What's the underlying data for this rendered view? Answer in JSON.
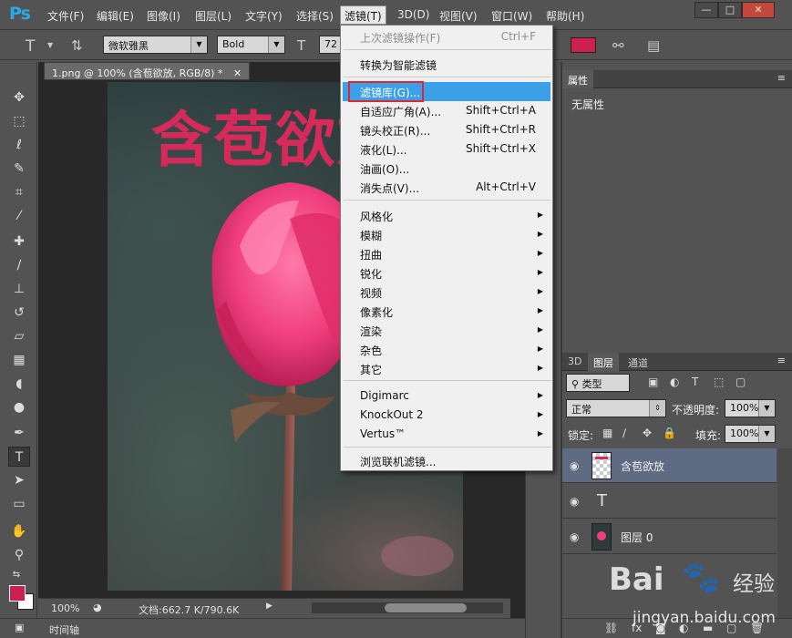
{
  "app": {
    "logo": "Ps"
  },
  "menubar": {
    "items": [
      "文件(F)",
      "编辑(E)",
      "图像(I)",
      "图层(L)",
      "文字(Y)",
      "选择(S)",
      "滤镜(T)",
      "3D(D)",
      "视图(V)",
      "窗口(W)",
      "帮助(H)"
    ],
    "active_index": 6,
    "window_buttons": [
      "—",
      "□",
      "✕"
    ]
  },
  "options_bar": {
    "font_family": "微软雅黑",
    "font_style": "Bold",
    "font_size": "72",
    "text_color": "#cf1f4f"
  },
  "document": {
    "tab_title": "1.png @ 100% (含苞欲放, RGB/8) *",
    "canvas_text": "含苞欲放",
    "text_color": "#d62a5b"
  },
  "status": {
    "zoom": "100%",
    "doc_info": "文档:662.7 K/790.6K"
  },
  "timeline": {
    "label": "时间轴"
  },
  "filter_menu": {
    "items": [
      {
        "label": "上次滤镜操作(F)",
        "shortcut": "Ctrl+F",
        "disabled": true
      },
      {
        "label": "转换为智能滤镜"
      },
      {
        "label": "滤镜库(G)...",
        "highlight": true
      },
      {
        "label": "自适应广角(A)...",
        "shortcut": "Shift+Ctrl+A"
      },
      {
        "label": "镜头校正(R)...",
        "shortcut": "Shift+Ctrl+R"
      },
      {
        "label": "液化(L)...",
        "shortcut": "Shift+Ctrl+X"
      },
      {
        "label": "油画(O)..."
      },
      {
        "label": "消失点(V)...",
        "shortcut": "Alt+Ctrl+V"
      },
      {
        "label": "风格化",
        "submenu": true
      },
      {
        "label": "模糊",
        "submenu": true
      },
      {
        "label": "扭曲",
        "submenu": true
      },
      {
        "label": "锐化",
        "submenu": true
      },
      {
        "label": "视频",
        "submenu": true
      },
      {
        "label": "像素化",
        "submenu": true
      },
      {
        "label": "渲染",
        "submenu": true
      },
      {
        "label": "杂色",
        "submenu": true
      },
      {
        "label": "其它",
        "submenu": true
      },
      {
        "label": "Digimarc",
        "submenu": true
      },
      {
        "label": "KnockOut 2",
        "submenu": true
      },
      {
        "label": "Vertus™",
        "submenu": true
      },
      {
        "label": "浏览联机滤镜..."
      }
    ]
  },
  "properties_panel": {
    "tab": "属性",
    "content": "无属性"
  },
  "layers_panel": {
    "tabs": [
      "3D",
      "图层",
      "通道"
    ],
    "active_tab": 1,
    "filter_kind": "类型",
    "blend_mode": "正常",
    "opacity_label": "不透明度:",
    "opacity": "100%",
    "lock_label": "锁定:",
    "fill_label": "填充:",
    "fill": "100%",
    "layers": [
      {
        "name": "含苞欲放",
        "thumb": "transparent",
        "selected": true
      },
      {
        "name": "",
        "thumb": "text-icon"
      },
      {
        "name": "图层 0",
        "thumb": "rose"
      }
    ]
  },
  "watermark": {
    "brand": "Bai",
    "brand2": "经验",
    "url": "jingyan.baidu.com"
  }
}
